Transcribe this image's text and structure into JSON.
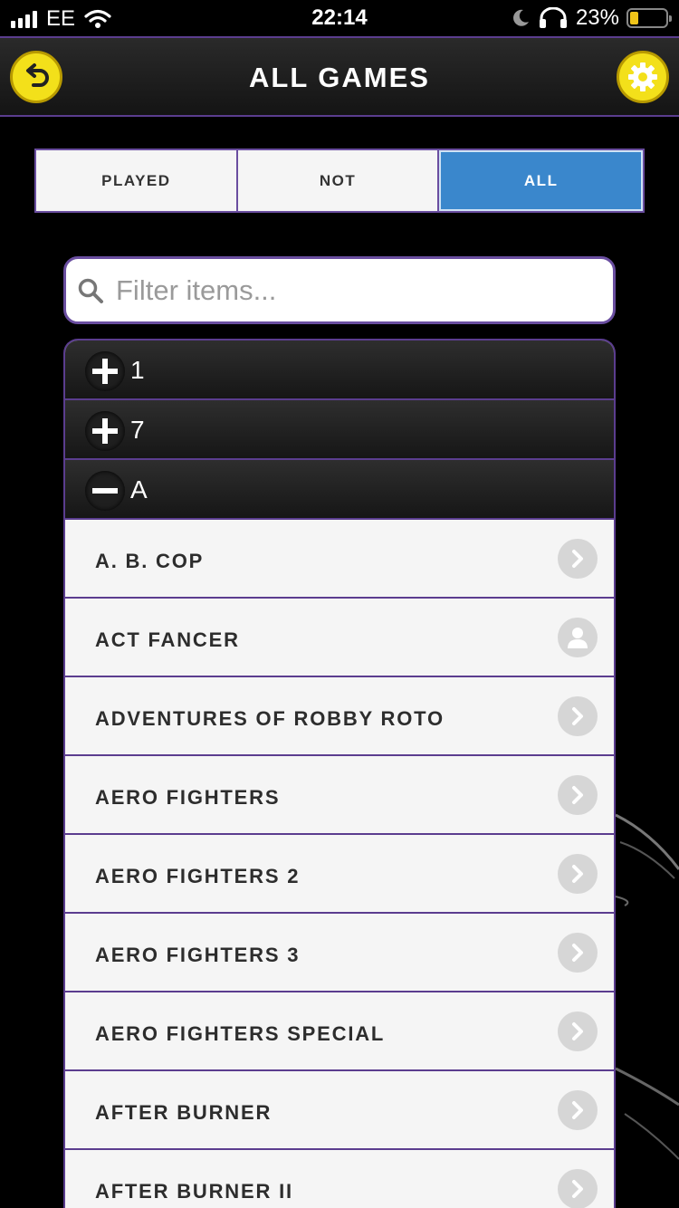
{
  "status_bar": {
    "carrier": "EE",
    "time": "22:14",
    "battery_percent": "23%",
    "battery_level": 0.23,
    "icons": [
      "signal-icon",
      "wifi-icon",
      "moon-icon",
      "headphones-icon",
      "battery-icon"
    ]
  },
  "header": {
    "title": "ALL GAMES",
    "back_icon": "back-arrow-icon",
    "settings_icon": "gear-icon",
    "button_color": "#f3e01a"
  },
  "segments": {
    "items": [
      "PLAYED",
      "NOT",
      "ALL"
    ],
    "selected": "ALL",
    "active_color": "#3a87cc"
  },
  "search": {
    "placeholder": "Filter items...",
    "value": ""
  },
  "groups": [
    {
      "label": "1",
      "expanded": false
    },
    {
      "label": "7",
      "expanded": false
    },
    {
      "label": "A",
      "expanded": true
    }
  ],
  "games": [
    {
      "title": "A. B. COP",
      "icon": "chevron-right-icon"
    },
    {
      "title": "ACT FANCER",
      "icon": "user-icon"
    },
    {
      "title": "ADVENTURES OF ROBBY ROTO",
      "icon": "chevron-right-icon"
    },
    {
      "title": "AERO FIGHTERS",
      "icon": "chevron-right-icon"
    },
    {
      "title": "AERO FIGHTERS 2",
      "icon": "chevron-right-icon"
    },
    {
      "title": "AERO FIGHTERS 3",
      "icon": "chevron-right-icon"
    },
    {
      "title": "AERO FIGHTERS SPECIAL",
      "icon": "chevron-right-icon"
    },
    {
      "title": "AFTER BURNER",
      "icon": "chevron-right-icon"
    },
    {
      "title": "AFTER BURNER II",
      "icon": "chevron-right-icon"
    }
  ],
  "colors": {
    "accent_border": "#5b3d8f",
    "row_background": "#f5f5f5"
  }
}
